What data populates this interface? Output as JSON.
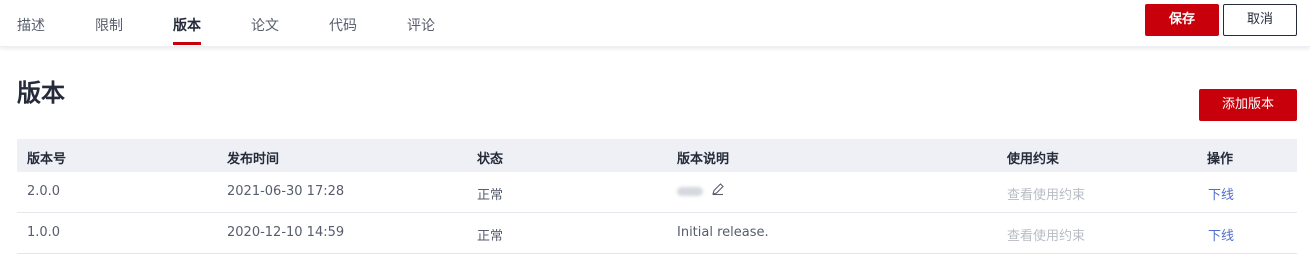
{
  "tabs": [
    {
      "label": "描述"
    },
    {
      "label": "限制"
    },
    {
      "label": "版本"
    },
    {
      "label": "论文"
    },
    {
      "label": "代码"
    },
    {
      "label": "评论"
    }
  ],
  "active_tab": "版本",
  "actions": {
    "save_label": "保存",
    "cancel_label": "取消"
  },
  "page": {
    "title": "版本",
    "add_version_label": "添加版本"
  },
  "table": {
    "headers": [
      "版本号",
      "发布时间",
      "状态",
      "版本说明",
      "使用约束",
      "操作"
    ],
    "rows": [
      {
        "version": "2.0.0",
        "time": "2021-06-30 17:28",
        "status": "正常",
        "note": "",
        "note_blurred": true,
        "constraint": "查看使用约束",
        "action": "下线"
      },
      {
        "version": "1.0.0",
        "time": "2020-12-10 14:59",
        "status": "正常",
        "note": "Initial release.",
        "note_blurred": false,
        "constraint": "查看使用约束",
        "action": "下线"
      }
    ]
  },
  "icons": {
    "edit": "pencil-edit-icon"
  },
  "colors": {
    "accent": "#c7000b",
    "link": "#526ecc",
    "muted": "#b8bcc4",
    "header_bg": "#eef0f5"
  }
}
